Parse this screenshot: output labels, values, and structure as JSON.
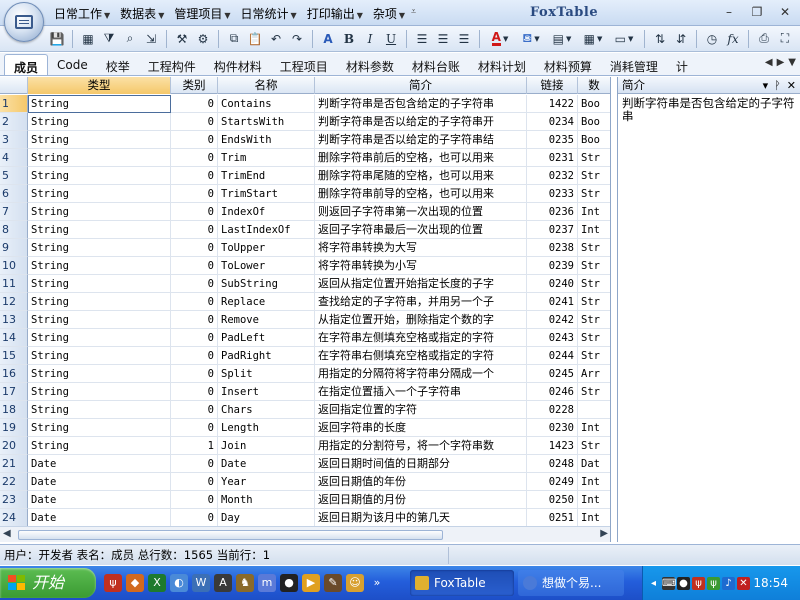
{
  "title_bar": {
    "app_title": "FoxTable",
    "quick_menus": [
      {
        "label": "日常工作"
      },
      {
        "label": "数据表"
      },
      {
        "label": "管理项目"
      },
      {
        "label": "日常统计"
      },
      {
        "label": "打印输出"
      },
      {
        "label": "杂项"
      }
    ],
    "window_buttons": {
      "minimize": "–",
      "restore": "❐",
      "close": "✕"
    }
  },
  "toolbar": {
    "bold": "B",
    "italic": "I",
    "underline": "U",
    "font_color": "A",
    "font_color_accent": "#d01818",
    "formula": "fx"
  },
  "tabs": {
    "items": [
      {
        "label": "成员"
      },
      {
        "label": "Code"
      },
      {
        "label": "校举"
      },
      {
        "label": "工程构件"
      },
      {
        "label": "构件材料"
      },
      {
        "label": "工程项目"
      },
      {
        "label": "材料参数"
      },
      {
        "label": "材料台账"
      },
      {
        "label": "材料计划"
      },
      {
        "label": "材料预算"
      },
      {
        "label": "消耗管理"
      },
      {
        "label": "计"
      }
    ],
    "active_index": 0
  },
  "grid": {
    "columns": [
      {
        "label": ""
      },
      {
        "label": "类型"
      },
      {
        "label": "类别"
      },
      {
        "label": "名称"
      },
      {
        "label": "简介"
      },
      {
        "label": "链接"
      },
      {
        "label": "数"
      }
    ],
    "rows": [
      {
        "n": "1",
        "type": "String",
        "cat": "0",
        "name": "Contains",
        "desc": "判断字符串是否包含给定的子字符串",
        "link": "1422",
        "dt": "Boo"
      },
      {
        "n": "2",
        "type": "String",
        "cat": "0",
        "name": "StartsWith",
        "desc": "判断字符串是否以给定的子字符串开",
        "link": "0234",
        "dt": "Boo"
      },
      {
        "n": "3",
        "type": "String",
        "cat": "0",
        "name": "EndsWith",
        "desc": "判断字符串是否以给定的子字符串结",
        "link": "0235",
        "dt": "Boo"
      },
      {
        "n": "4",
        "type": "String",
        "cat": "0",
        "name": "Trim",
        "desc": "删除字符串前后的空格，也可以用来",
        "link": "0231",
        "dt": "Str"
      },
      {
        "n": "5",
        "type": "String",
        "cat": "0",
        "name": "TrimEnd",
        "desc": "删除字符串尾随的空格，也可以用来",
        "link": "0232",
        "dt": "Str"
      },
      {
        "n": "6",
        "type": "String",
        "cat": "0",
        "name": "TrimStart",
        "desc": "删除字符串前导的空格，也可以用来",
        "link": "0233",
        "dt": "Str"
      },
      {
        "n": "7",
        "type": "String",
        "cat": "0",
        "name": "IndexOf",
        "desc": "则返回子字符串第一次出现的位置",
        "link": "0236",
        "dt": "Int"
      },
      {
        "n": "8",
        "type": "String",
        "cat": "0",
        "name": "LastIndexOf",
        "desc": "返回子字符串最后一次出现的位置",
        "link": "0237",
        "dt": "Int"
      },
      {
        "n": "9",
        "type": "String",
        "cat": "0",
        "name": "ToUpper",
        "desc": "将字符串转换为大写",
        "link": "0238",
        "dt": "Str"
      },
      {
        "n": "10",
        "type": "String",
        "cat": "0",
        "name": "ToLower",
        "desc": "将字符串转换为小写",
        "link": "0239",
        "dt": "Str"
      },
      {
        "n": "11",
        "type": "String",
        "cat": "0",
        "name": "SubString",
        "desc": "返回从指定位置开始指定长度的子字",
        "link": "0240",
        "dt": "Str"
      },
      {
        "n": "12",
        "type": "String",
        "cat": "0",
        "name": "Replace",
        "desc": "查找给定的子字符串，并用另一个子",
        "link": "0241",
        "dt": "Str"
      },
      {
        "n": "13",
        "type": "String",
        "cat": "0",
        "name": "Remove",
        "desc": "从指定位置开始，删除指定个数的字",
        "link": "0242",
        "dt": "Str"
      },
      {
        "n": "14",
        "type": "String",
        "cat": "0",
        "name": "PadLeft",
        "desc": "在字符串左侧填充空格或指定的字符",
        "link": "0243",
        "dt": "Str"
      },
      {
        "n": "15",
        "type": "String",
        "cat": "0",
        "name": "PadRight",
        "desc": "在字符串右侧填充空格或指定的字符",
        "link": "0244",
        "dt": "Str"
      },
      {
        "n": "16",
        "type": "String",
        "cat": "0",
        "name": "Split",
        "desc": "用指定的分隔符将字符串分隔成一个",
        "link": "0245",
        "dt": "Arr"
      },
      {
        "n": "17",
        "type": "String",
        "cat": "0",
        "name": "Insert",
        "desc": "在指定位置插入一个子字符串",
        "link": "0246",
        "dt": "Str"
      },
      {
        "n": "18",
        "type": "String",
        "cat": "0",
        "name": "Chars",
        "desc": "返回指定位置的字符",
        "link": "0228",
        "dt": ""
      },
      {
        "n": "19",
        "type": "String",
        "cat": "0",
        "name": "Length",
        "desc": "返回字符串的长度",
        "link": "0230",
        "dt": "Int"
      },
      {
        "n": "20",
        "type": "String",
        "cat": "1",
        "name": "Join",
        "desc": "用指定的分割符号，将一个字符串数",
        "link": "1423",
        "dt": "Str"
      },
      {
        "n": "21",
        "type": "Date",
        "cat": "0",
        "name": "Date",
        "desc": "返回日期时间值的日期部分",
        "link": "0248",
        "dt": "Dat"
      },
      {
        "n": "22",
        "type": "Date",
        "cat": "0",
        "name": "Year",
        "desc": "返回日期值的年份",
        "link": "0249",
        "dt": "Int"
      },
      {
        "n": "23",
        "type": "Date",
        "cat": "0",
        "name": "Month",
        "desc": "返回日期值的月份",
        "link": "0250",
        "dt": "Int"
      },
      {
        "n": "24",
        "type": "Date",
        "cat": "0",
        "name": "Day",
        "desc": "返回日期为该月中的第几天",
        "link": "0251",
        "dt": "Int"
      }
    ]
  },
  "panel": {
    "title": "简介",
    "content": "判断字符串是否包含给定的子字符串",
    "btn_dropdown": "▾",
    "btn_pin": "ᚹ",
    "btn_close": "✕"
  },
  "status_bar": {
    "text": "用户：开发者  表名：成员  总行数：1565  当前行：1"
  },
  "taskbar": {
    "start_label": "开始",
    "tasks": [
      {
        "label": "FoxTable"
      },
      {
        "label": "想做个易..."
      }
    ],
    "clock": "18:54",
    "colors": {
      "start": "#3a9a32",
      "taskbar": "#245edb",
      "tray": "#0f7fd9"
    }
  }
}
